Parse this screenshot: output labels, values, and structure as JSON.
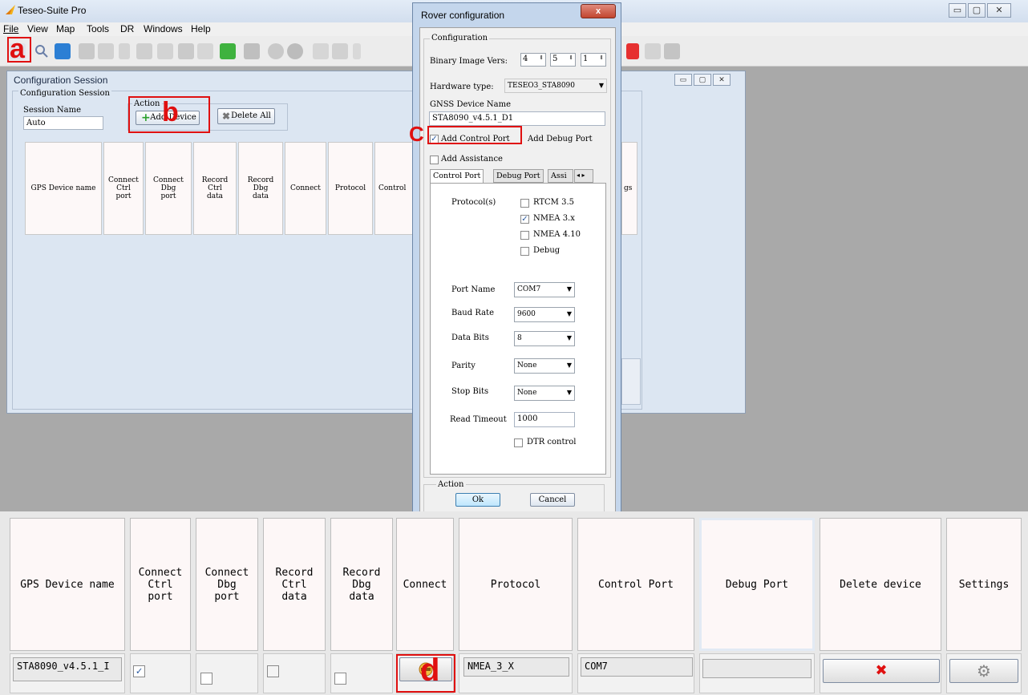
{
  "app": {
    "title": "Teseo-Suite Pro",
    "window_controls": [
      "▭",
      "▢",
      "✕"
    ]
  },
  "menu": [
    "File",
    "View",
    "Map",
    "Tools",
    "DR",
    "Windows",
    "Help"
  ],
  "annotations": {
    "a": "a",
    "b": "b",
    "c": "C",
    "d": "d"
  },
  "config_session": {
    "window_title": "Configuration Session",
    "group_label": "Configuration Session",
    "session_name_label": "Session Name",
    "session_name_value": "Auto",
    "action_label": "Action",
    "add_device_label": "Add Device",
    "delete_all_label": "Delete All",
    "columns": [
      "GPS Device name",
      "Connect\nCtrl\nport",
      "Connect\nDbg\nport",
      "Record\nCtrl\ndata",
      "Record\nDbg\ndata",
      "Connect",
      "Protocol",
      "Control"
    ],
    "trailing_fragment": "gs"
  },
  "rover": {
    "title": "Rover configuration",
    "close": "x",
    "configuration_label": "Configuration",
    "binary_image_label": "Binary Image Vers:",
    "binary_version": [
      "4",
      "5",
      "1"
    ],
    "hardware_type_label": "Hardware type:",
    "hardware_type_value": "TESEO3_STA8090",
    "gnss_device_name_label": "GNSS Device Name",
    "gnss_device_name_value": "STA8090_v4.5.1_D1",
    "add_control_port": "Add Control Port",
    "add_debug_port": "Add Debug Port",
    "add_assistance": "Add Assistance",
    "tabs": [
      "Control Port",
      "Debug Port",
      "Assi"
    ],
    "protocols_label": "Protocol(s)",
    "protocols": [
      {
        "label": "RTCM 3.5",
        "checked": false
      },
      {
        "label": "NMEA 3.x",
        "checked": true
      },
      {
        "label": "NMEA 4.10",
        "checked": false
      },
      {
        "label": "Debug",
        "checked": false
      }
    ],
    "port_name_label": "Port Name",
    "port_name_value": "COM7",
    "baud_rate_label": "Baud Rate",
    "baud_rate_value": "9600",
    "data_bits_label": "Data Bits",
    "data_bits_value": "8",
    "parity_label": "Parity",
    "parity_value": "None",
    "stop_bits_label": "Stop Bits",
    "stop_bits_value": "None",
    "read_timeout_label": "Read Timeout",
    "read_timeout_value": "1000",
    "dtr_control_label": "DTR control",
    "action_label": "Action",
    "ok_label": "Ok",
    "cancel_label": "Cancel"
  },
  "grid": {
    "columns": [
      "GPS Device name",
      "Connect\nCtrl\nport",
      "Connect\nDbg\nport",
      "Record\nCtrl\ndata",
      "Record\nDbg\ndata",
      "Connect",
      "Protocol",
      "Control Port",
      "Debug Port",
      "Delete device",
      "Settings"
    ],
    "row": {
      "device_name": "STA8090_v4.5.1_I",
      "connect_ctrl_checked": true,
      "connect_dbg_checked": false,
      "record_ctrl_checked": false,
      "record_dbg_checked": false,
      "protocol": "NMEA_3_X",
      "control_port": "COM7",
      "debug_port": ""
    }
  }
}
